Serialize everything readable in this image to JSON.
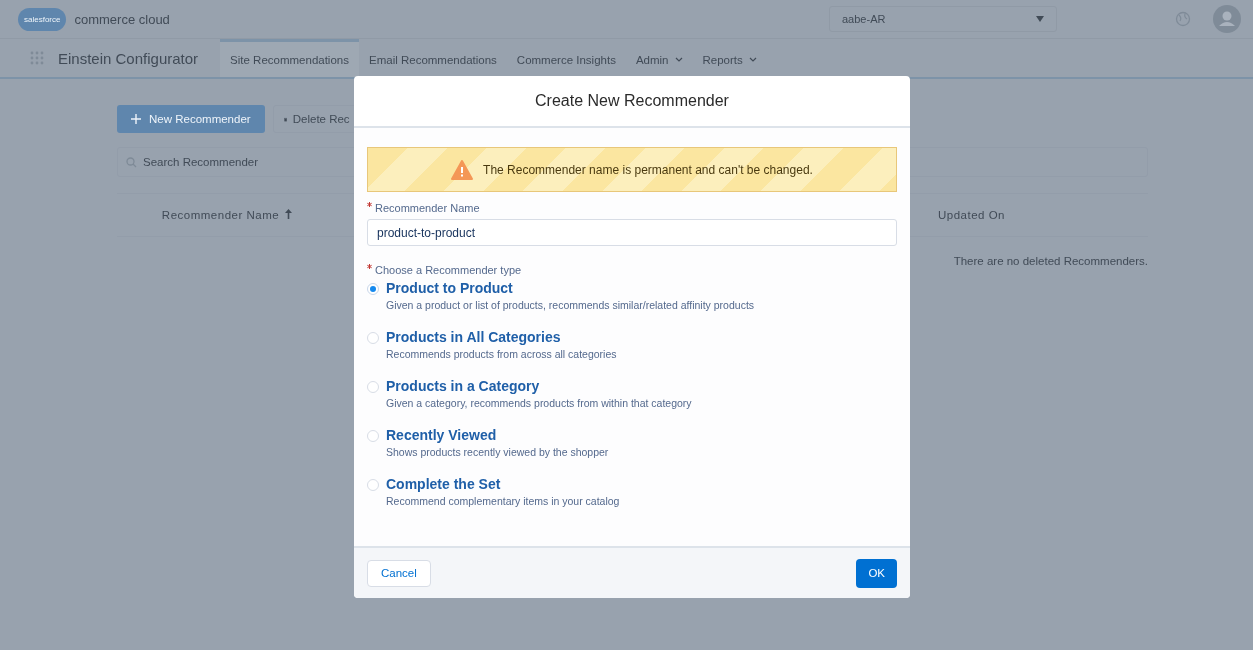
{
  "header": {
    "logo_text": "salesforce",
    "product_name": "commerce cloud",
    "site_select": {
      "value": "aabe-AR"
    }
  },
  "nav": {
    "app_name": "Einstein Configurator",
    "tabs": [
      {
        "label": "Site Recommendations",
        "selected": true,
        "dropdown": false
      },
      {
        "label": "Email Recommendations",
        "selected": false,
        "dropdown": false
      },
      {
        "label": "Commerce Insights",
        "selected": false,
        "dropdown": false
      },
      {
        "label": "Admin",
        "selected": false,
        "dropdown": true
      },
      {
        "label": "Reports",
        "selected": false,
        "dropdown": true
      }
    ]
  },
  "toolbar": {
    "new_button": "New Recommender",
    "delete_button": "Delete Rec"
  },
  "search": {
    "placeholder": "Search Recommender"
  },
  "table": {
    "columns": [
      "Recommender Name",
      "Updated On"
    ],
    "empty_message": "There are no deleted Recommenders."
  },
  "modal": {
    "title": "Create New Recommender",
    "warning": "The Recommender name is permanent and can't be changed.",
    "name_field": {
      "label": "Recommender Name",
      "value": "product-to-product",
      "required": true
    },
    "type_label": "Choose a Recommender type",
    "type_required": true,
    "options": [
      {
        "title": "Product to Product",
        "description": "Given a product or list of products, recommends similar/related affinity products",
        "selected": true
      },
      {
        "title": "Products in All Categories",
        "description": "Recommends products from across all categories",
        "selected": false
      },
      {
        "title": "Products in a Category",
        "description": "Given a category, recommends products from within that category",
        "selected": false
      },
      {
        "title": "Recently Viewed",
        "description": "Shows products recently viewed by the shopper",
        "selected": false
      },
      {
        "title": "Complete the Set",
        "description": "Recommend complementary items in your catalog",
        "selected": false
      }
    ],
    "cancel_button": "Cancel",
    "ok_button": "OK"
  }
}
